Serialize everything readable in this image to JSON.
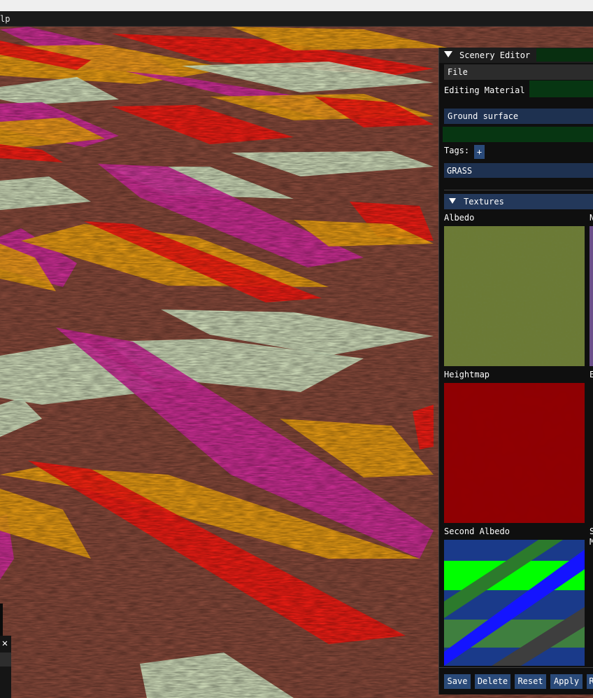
{
  "menubar": {
    "help_label": "lp"
  },
  "viewport": {
    "description": "3D scene viewport"
  },
  "floating_window": {
    "close_glyph": "✕"
  },
  "scenery_editor": {
    "title": "Scenery Editor [",
    "menu": {
      "file_label": "File"
    },
    "editing_material_label": "Editing Material",
    "material_name": "Ground surface",
    "tags_label": "Tags:",
    "add_tag_glyph": "+",
    "tags": [
      "GRASS"
    ],
    "textures_section_label": "Textures",
    "textures": {
      "albedo": {
        "label": "Albedo",
        "color": "#6b7a33"
      },
      "normal_label_partial": "N",
      "heightmap": {
        "label": "Heightmap",
        "color": "#8e0003"
      },
      "second_column_label_partial": "E",
      "second_albedo": {
        "label": "Second Albedo"
      },
      "third_column_label_partial": "S",
      "third_column_label_partial_2": "M"
    },
    "buttons": {
      "save": "Save",
      "delete": "Delete",
      "reset": "Reset",
      "apply": "Apply",
      "partial": "R"
    }
  },
  "colors": {
    "panel_bg": "#0f0f0f",
    "accent_blue": "#2a4a79",
    "dark_green": "#073612",
    "ground_brown": "#8a4b3c",
    "stripe_red": "#ff1a12",
    "stripe_orange": "#f5a612",
    "stripe_magenta": "#d62ca0",
    "stripe_pale": "#d8ecc8"
  }
}
